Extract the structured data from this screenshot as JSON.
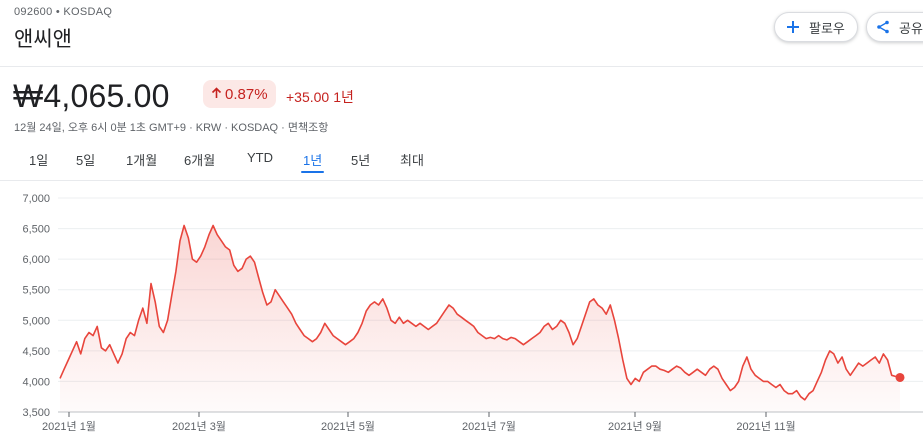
{
  "header": {
    "ticker": "092600 • KOSDAQ",
    "company": "앤씨앤",
    "follow_label": "팔로우",
    "share_label": "공유"
  },
  "quote": {
    "price": "₩4,065.00",
    "change_pct": "0.87%",
    "change_abs": "+35.00",
    "period": "1년",
    "meta": "12월 24일, 오후 6시 0분 1초 GMT+9 · KRW · KOSDAQ · 면책조항",
    "up_color": "#c5221f"
  },
  "tabs": [
    {
      "label": "1일",
      "active": false
    },
    {
      "label": "5일",
      "active": false
    },
    {
      "label": "1개월",
      "active": false
    },
    {
      "label": "6개월",
      "active": false
    },
    {
      "label": "YTD",
      "active": false
    },
    {
      "label": "1년",
      "active": true
    },
    {
      "label": "5년",
      "active": false
    },
    {
      "label": "최대",
      "active": false
    }
  ],
  "chart_data": {
    "type": "area",
    "ylim": [
      3500,
      7000
    ],
    "yticks": [
      "7,000",
      "6,500",
      "6,000",
      "5,500",
      "5,000",
      "4,500",
      "4,000",
      "3,500"
    ],
    "xticks": [
      "2021년 1월",
      "2021년 3월",
      "2021년 5월",
      "2021년 7월",
      "2021년 9월",
      "2021년 11월"
    ],
    "line_color": "#e8453c",
    "series": [
      {
        "values": [
          4050,
          4200,
          4350,
          4500,
          4650,
          4450,
          4700,
          4800,
          4750,
          4900,
          4550,
          4500,
          4600,
          4450,
          4300,
          4450,
          4700,
          4800,
          4750,
          5000,
          5200,
          4950,
          5600,
          5300,
          4900,
          4800,
          5000,
          5400,
          5800,
          6300,
          6550,
          6350,
          6000,
          5950,
          6050,
          6200,
          6400,
          6550,
          6400,
          6300,
          6200,
          6150,
          5900,
          5800,
          5850,
          6000,
          6050,
          5950,
          5700,
          5450,
          5250,
          5300,
          5500,
          5400,
          5300,
          5200,
          5100,
          4950,
          4850,
          4750,
          4700,
          4650,
          4700,
          4800,
          4950,
          4850,
          4750,
          4700,
          4650,
          4600,
          4650,
          4700,
          4800,
          4950,
          5150,
          5250,
          5300,
          5250,
          5350,
          5200,
          5000,
          4950,
          5050,
          4950,
          5000,
          4950,
          4900,
          4950,
          4900,
          4850,
          4900,
          4950,
          5050,
          5150,
          5250,
          5200,
          5100,
          5050,
          5000,
          4950,
          4900,
          4800,
          4750,
          4700,
          4720,
          4700,
          4750,
          4700,
          4680,
          4720,
          4700,
          4650,
          4600,
          4650,
          4700,
          4750,
          4800,
          4900,
          4950,
          4850,
          4900,
          5000,
          4950,
          4800,
          4600,
          4700,
          4900,
          5100,
          5300,
          5350,
          5250,
          5200,
          5100,
          5250,
          5000,
          4700,
          4350,
          4050,
          3950,
          4050,
          4000,
          4150,
          4200,
          4250,
          4250,
          4200,
          4180,
          4150,
          4200,
          4250,
          4220,
          4150,
          4100,
          4150,
          4200,
          4150,
          4100,
          4200,
          4250,
          4200,
          4050,
          3950,
          3850,
          3900,
          4000,
          4250,
          4400,
          4200,
          4100,
          4050,
          4000,
          4000,
          3950,
          3900,
          3950,
          3850,
          3800,
          3800,
          3850,
          3750,
          3700,
          3800,
          3850,
          4000,
          4150,
          4350,
          4500,
          4450,
          4300,
          4400,
          4200,
          4100,
          4200,
          4300,
          4250,
          4300,
          4350,
          4400,
          4300,
          4450,
          4350,
          4100,
          4080,
          4065
        ]
      }
    ],
    "last_value": 4065
  }
}
